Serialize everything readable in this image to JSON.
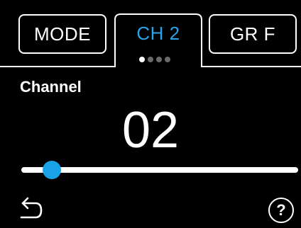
{
  "tabs": [
    {
      "label": "MODE",
      "active": false
    },
    {
      "label": "CH 2",
      "active": true
    },
    {
      "label": "GR F",
      "active": false
    }
  ],
  "pager": {
    "total": 4,
    "current": 1
  },
  "section": {
    "label": "Channel"
  },
  "value": {
    "display": "02"
  },
  "slider": {
    "fraction": 0.11
  },
  "footer": {
    "back_icon": "back-arrow-icon",
    "help_label": "?"
  },
  "colors": {
    "background": "#000000",
    "accent": "#2aa3e8",
    "foreground": "#ffffff",
    "dot_inactive": "#6a6a6a"
  }
}
